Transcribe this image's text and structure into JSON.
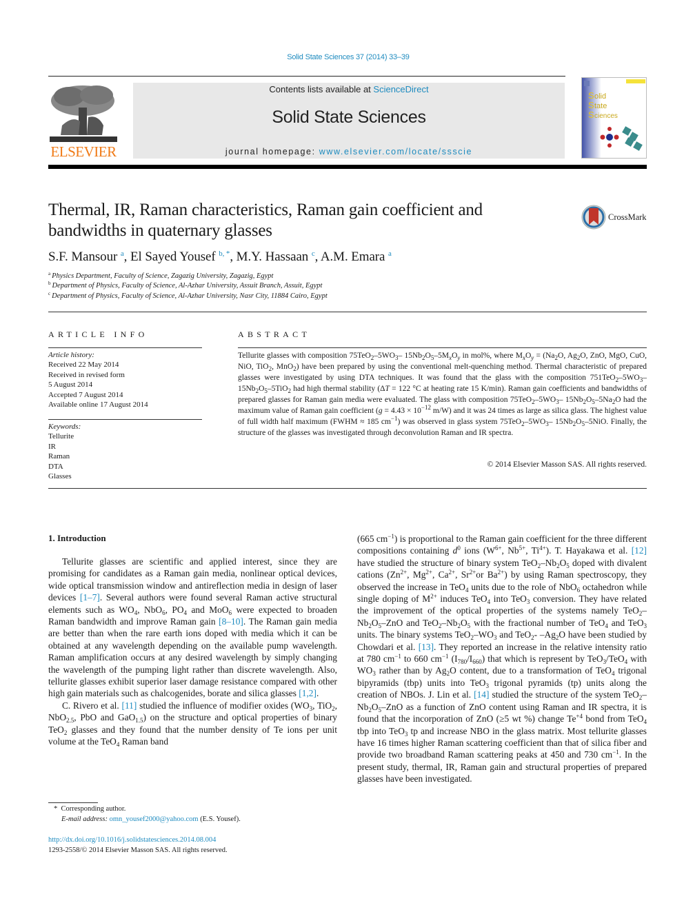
{
  "header": {
    "journal_ref": "Solid State Sciences 37 (2014) 33–39",
    "contents_prefix": "Contents lists available at ",
    "contents_link": "ScienceDirect",
    "journal_title": "Solid State Sciences",
    "homepage_prefix": "journal homepage: ",
    "homepage_link": "www.elsevier.com/locate/ssscie",
    "publisher_logo": "ELSEVIER",
    "cover_title_lines": [
      "Solid",
      "State",
      "Sciences"
    ]
  },
  "article": {
    "title": "Thermal, IR, Raman characteristics, Raman gain coefficient and bandwidths in quaternary glasses",
    "crossmark_label": "CrossMark",
    "authors": [
      {
        "name": "S.F. Mansour",
        "sup": "a"
      },
      {
        "name": "El Sayed Yousef",
        "sup": "b, *"
      },
      {
        "name": "M.Y. Hassaan",
        "sup": "c"
      },
      {
        "name": "A.M. Emara",
        "sup": "a"
      }
    ],
    "affiliations": [
      {
        "key": "a",
        "text": "Physics Department, Faculty of Science, Zagazig University, Zagazig, Egypt"
      },
      {
        "key": "b",
        "text": "Department of Physics, Faculty of Science, Al-Azhar University, Assuit Branch, Assuit, Egypt"
      },
      {
        "key": "c",
        "text": "Department of Physics, Faculty of Science, Al-Azhar University, Nasr City, 11884 Cairo, Egypt"
      }
    ]
  },
  "article_info": {
    "heading": "ARTICLE INFO",
    "history_label": "Article history:",
    "history": [
      "Received 22 May 2014",
      "Received in revised form",
      "5 August 2014",
      "Accepted 7 August 2014",
      "Available online 17 August 2014"
    ],
    "keywords_label": "Keywords:",
    "keywords": [
      "Tellurite",
      "IR",
      "Raman",
      "DTA",
      "Glasses"
    ]
  },
  "abstract": {
    "heading": "ABSTRACT",
    "copyright": "© 2014 Elsevier Masson SAS. All rights reserved."
  },
  "introduction": {
    "heading": "1.  Introduction",
    "refs": {
      "r1": "[1–7]",
      "r2": "[8–10]",
      "r3": "[1,2]",
      "r4": "[11]",
      "r5": "[12]",
      "r6": "[13]",
      "r7": "[14]"
    }
  },
  "footnote": {
    "star_text": "Corresponding author.",
    "email_label": "E-mail address:",
    "email": "omn_yousef2000@yahoo.com",
    "email_owner": "(E.S. Yousef).",
    "doi": "http://dx.doi.org/10.1016/j.solidstatesciences.2014.08.004",
    "issn_copyright": "1293-2558/© 2014 Elsevier Masson SAS. All rights reserved."
  }
}
